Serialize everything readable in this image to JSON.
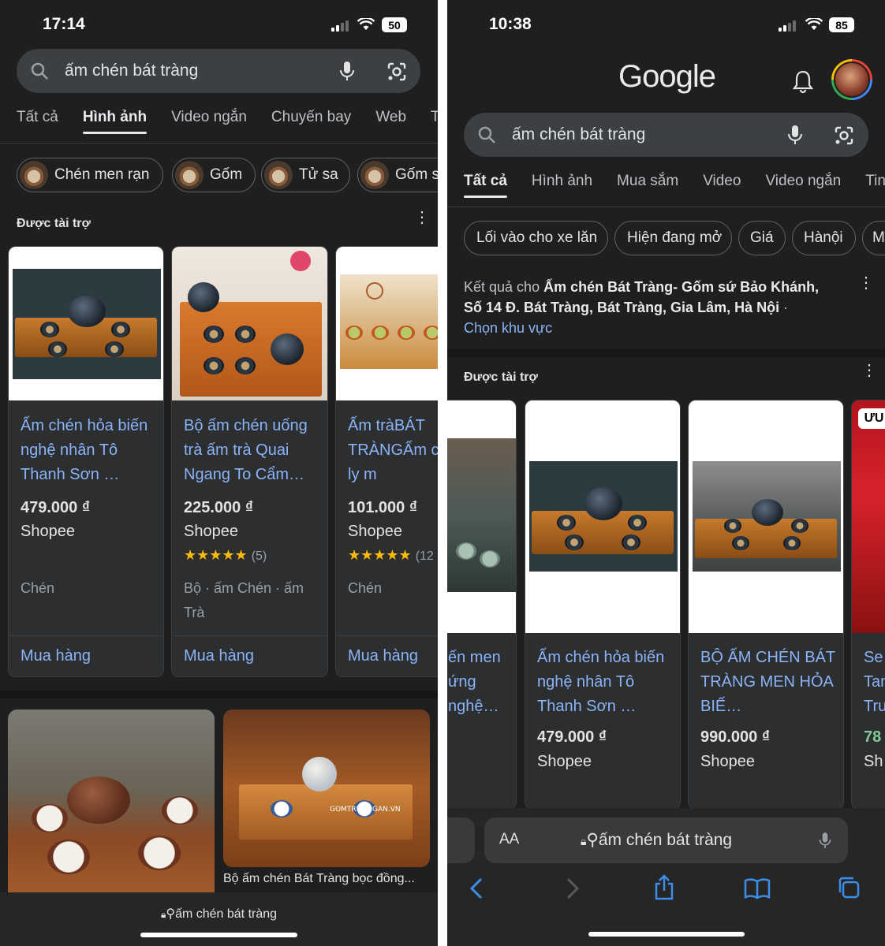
{
  "left": {
    "status": {
      "time": "17:14",
      "battery": "50"
    },
    "search": {
      "query": "ấm chén bát tràng"
    },
    "tabs": [
      "Tất cả",
      "Hình ảnh",
      "Video ngắn",
      "Chuyến bay",
      "Web",
      "Ta"
    ],
    "active_tab": "Hình ảnh",
    "chips": [
      "Chén men rạn",
      "Gốm",
      "Tử sa",
      "Gốm s"
    ],
    "sponsored": "Được tài trợ",
    "products": [
      {
        "title": "Ấm chén hỏa biến nghệ nhân Tô Thanh Sơn …",
        "price": "479.000 ₫",
        "store": "Shopee",
        "rating": "",
        "reviews": "",
        "category": "Chén",
        "buy": "Mua hàng"
      },
      {
        "title": "Bộ ấm chén uống trà ấm trà Quai Ngang To Cẩm…",
        "price": "225.000 ₫",
        "store": "Shopee",
        "rating": "★★★★★",
        "reviews": "(5)",
        "category": "Bộ · ấm Chén · ấm Trà",
        "buy": "Mua hàng"
      },
      {
        "title": "Ấm tràBÁT TRÀNGẤm c tách trà, ly m",
        "price": "101.000 ₫",
        "store": "Shopee",
        "rating": "★★★★★",
        "reviews": "(12",
        "category": "Chén",
        "buy": "Mua hàng"
      }
    ],
    "image_results": [
      {
        "caption": ""
      },
      {
        "caption": "Bộ ấm chén Bát Tràng bọc đồng..."
      }
    ],
    "url_bar": "ấm chén bát tràng",
    "watermark": "GOMTRUONGAN.VN"
  },
  "right": {
    "status": {
      "time": "10:38",
      "battery": "85"
    },
    "logo": "Google",
    "search": {
      "query": "ấm chén bát tràng"
    },
    "tabs": [
      "Tất cả",
      "Hình ảnh",
      "Mua sắm",
      "Video",
      "Video ngắn",
      "Tin"
    ],
    "active_tab": "Tất cả",
    "chips": [
      "Lối vào cho xe lăn",
      "Hiện đang mở",
      "Giá",
      "Hànội",
      "M"
    ],
    "location": {
      "prefix": "Kết quả cho ",
      "place": "Ấm chén Bát Tràng- Gốm sứ Bảo Khánh, Số 14 Đ. Bát Tràng, Bát Tràng, Gia Lâm, Hà Nội",
      "suffix": " ·",
      "link": "Chọn khu vực"
    },
    "sponsored": "Được tài trợ",
    "products": [
      {
        "title": "ến men ứng nghệ…",
        "price": "",
        "store": ""
      },
      {
        "title": "Ấm chén hỏa biến nghệ nhân Tô Thanh Sơn …",
        "price": "479.000 ₫",
        "store": "Shopee"
      },
      {
        "title": "BỘ ẤM CHÉN BÁT TRÀNG MEN HỎA BIẾ…",
        "price": "990.000 ₫",
        "store": "Shopee"
      },
      {
        "title": "Se Tan Tru",
        "price": "78",
        "store": "Sh",
        "badge": "ƯU"
      }
    ],
    "url_bar": {
      "aa": "AA",
      "text": "ấm chén bát tràng"
    }
  },
  "colors": {
    "bg": "#1f1f1f",
    "link": "#8ab4f8",
    "safari_blue": "#3b8eea",
    "star": "#fbbc04"
  }
}
